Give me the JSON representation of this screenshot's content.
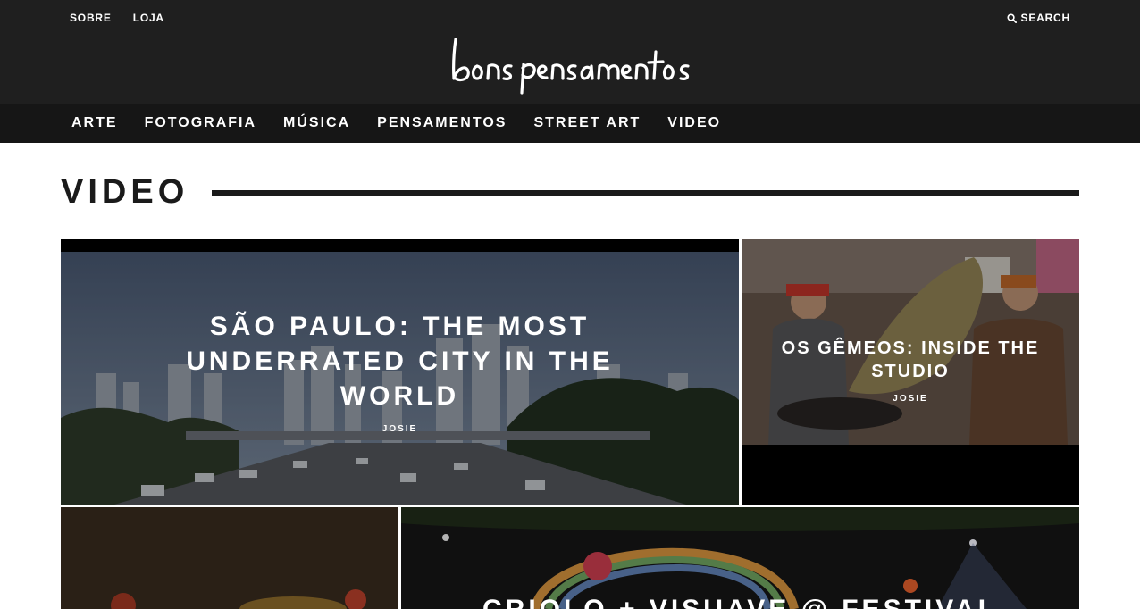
{
  "header": {
    "links": [
      "SOBRE",
      "LOJA"
    ],
    "search_label": "SEARCH",
    "logo_text": "bons pensamentos"
  },
  "nav": {
    "categories": [
      "ARTE",
      "FOTOGRAFIA",
      "MÚSICA",
      "PENSAMENTOS",
      "STREET ART",
      "VIDEO"
    ]
  },
  "page": {
    "title": "VIDEO"
  },
  "posts": [
    {
      "title": "SÃO PAULO: THE MOST UNDERRATED CITY IN THE WORLD",
      "author": "JOSIE"
    },
    {
      "title": "OS GÊMEOS: INSIDE THE STUDIO",
      "author": "JOSIE"
    },
    {
      "title": "",
      "author": ""
    },
    {
      "title": "CRIOLO + VISUAVE @ FESTIVAL",
      "author": ""
    }
  ],
  "colors": {
    "header_bg": "#1f1f1f",
    "nav_bg": "#161616",
    "text_dark": "#1a1a1a"
  }
}
